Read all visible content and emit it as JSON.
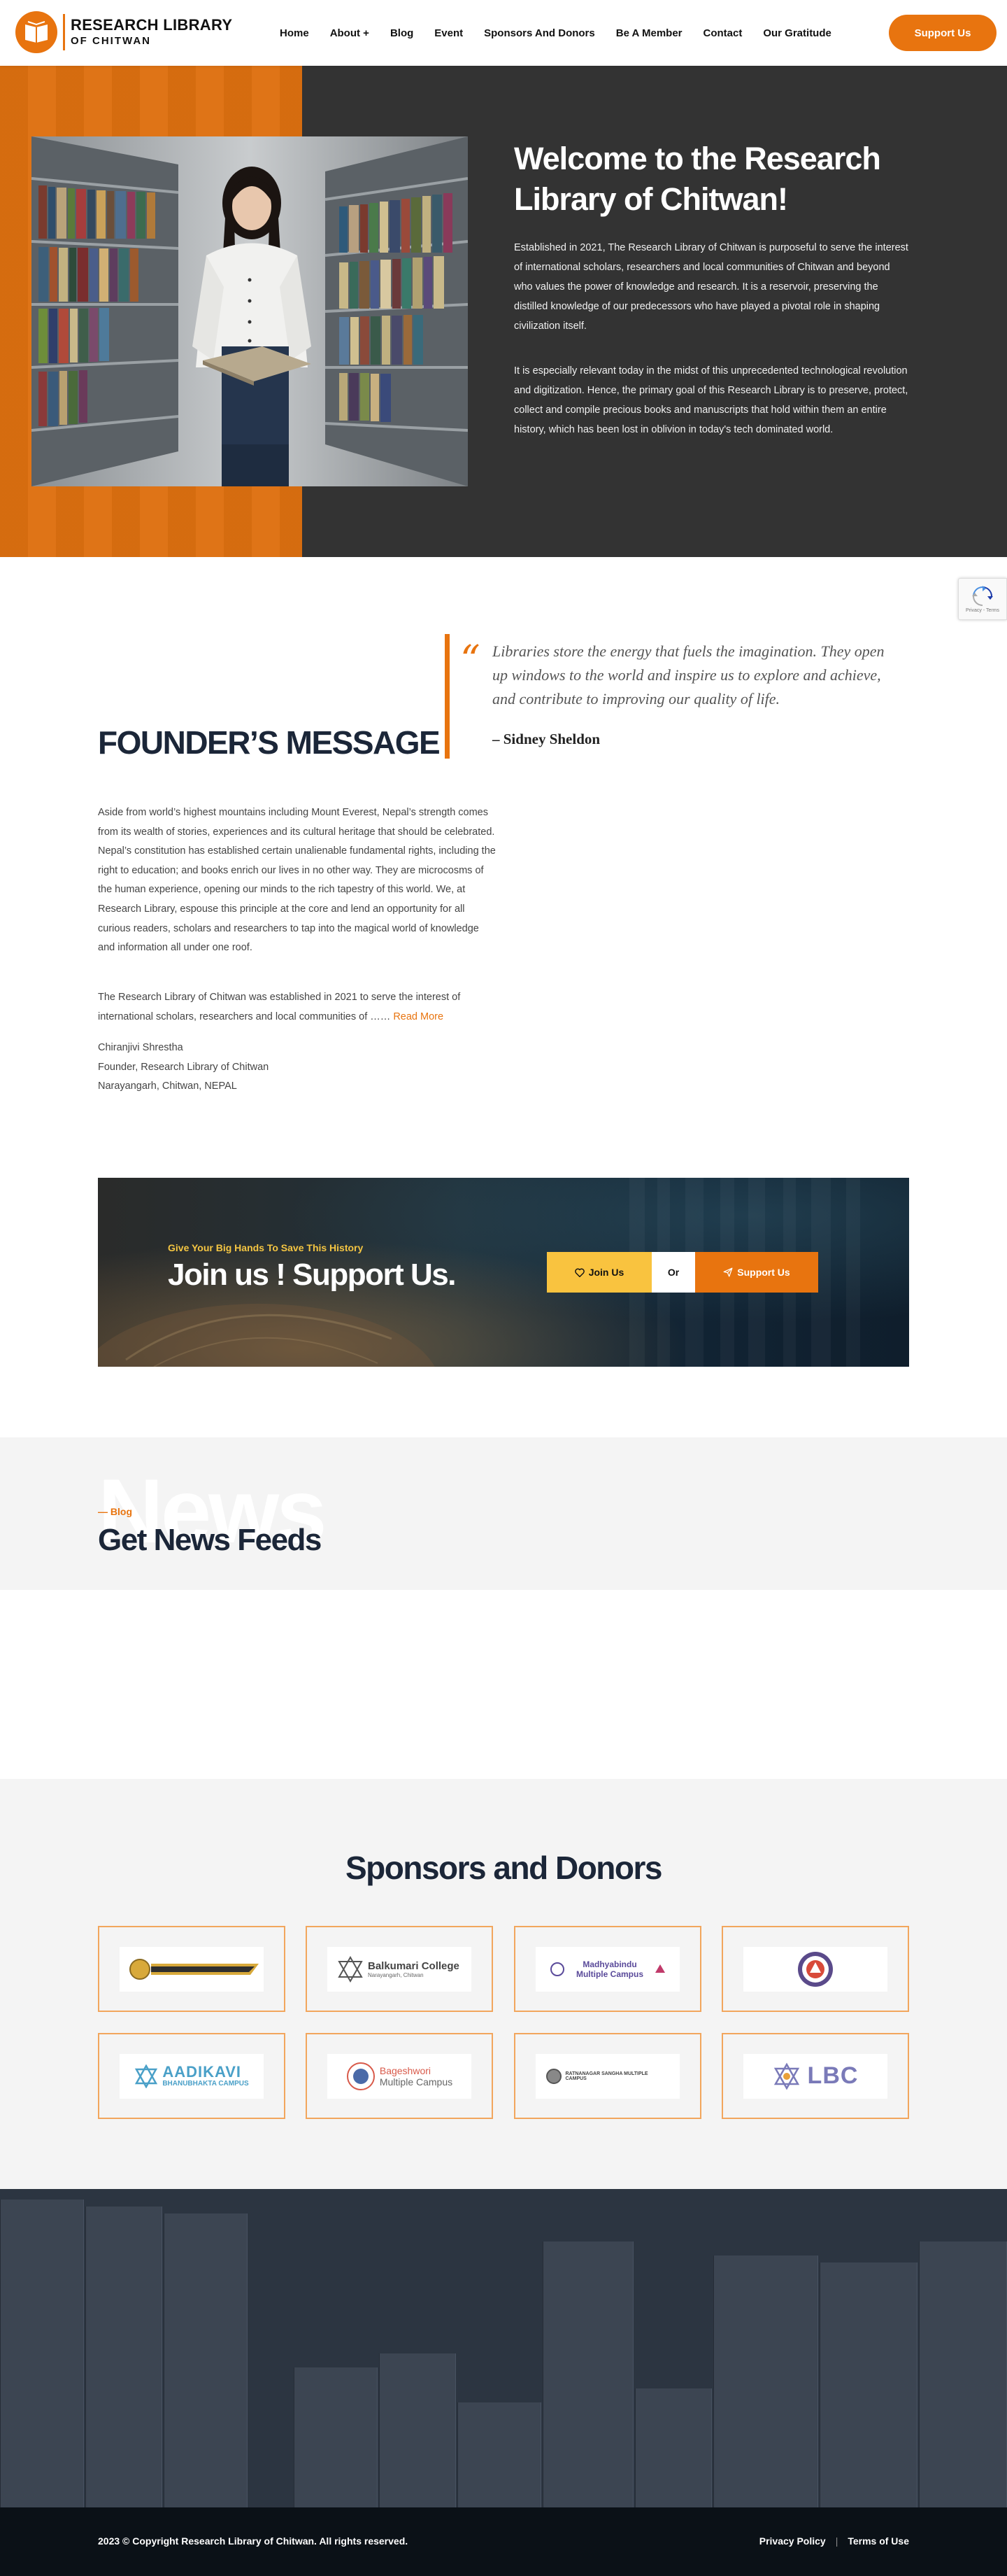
{
  "header": {
    "logo_line1": "RESEARCH LIBRARY",
    "logo_line2": "OF CHITWAN",
    "nav": [
      "Home",
      "About +",
      "Blog",
      "Event",
      "Sponsors And Donors",
      "Be A Member",
      "Contact",
      "Our Gratitude"
    ],
    "support_label": "Support Us"
  },
  "hero": {
    "title": "Welcome to the Research Library of Chitwan!",
    "p1": "Established in 2021, The Research Library of Chitwan is purposeful to serve the interest of international scholars, researchers and local communities of Chitwan and beyond who values the power of knowledge and research. It is a reservoir, preserving the distilled knowledge of our predecessors who have played a pivotal role in shaping civilization itself.",
    "p2": "It is especially relevant today in the midst of this unprecedented technological revolution and digitization. Hence, the primary goal of this Research Library is to preserve, protect, collect and compile precious books and manuscripts that hold within them an entire history, which has been lost in oblivion in today's tech dominated world."
  },
  "founder": {
    "quote_mark": "“",
    "quote": "Libraries store the energy that fuels the imagination. They open up windows to the world and inspire us to explore and achieve, and contribute to improving our quality of life.",
    "quote_author": "– Sidney Sheldon",
    "title": "FOUNDER’S MESSAGE",
    "p1": "Aside from world’s highest mountains including Mount Everest, Nepal’s strength comes from its wealth of stories, experiences and its cultural heritage that should be celebrated. Nepal’s constitution has established certain unalienable fundamental rights, including the right to education; and books enrich our lives in no other way. They are microcosms of the human experience, opening our minds to the rich tapestry of this world. We, at Research Library, espouse this principle at the core and lend an opportunity for all curious readers, scholars and researchers to tap into the magical world of knowledge and information all under one roof.",
    "p2": "The Research Library of Chitwan was established in 2021 to serve the interest of international scholars, researchers and local communities of …… ",
    "read_more": "Read More",
    "sig_name": "Chiranjivi Shrestha",
    "sig_role": "Founder, Research Library of Chitwan",
    "sig_place": "Narayangarh, Chitwan, NEPAL"
  },
  "join": {
    "subtitle": "Give Your Big Hands To Save This History",
    "title": "Join us ! Support Us.",
    "join_label": "Join Us",
    "or_label": "Or",
    "support_label": "Support Us"
  },
  "news": {
    "bg_word": "News",
    "subtitle": "— Blog",
    "title": "Get News Feeds"
  },
  "sponsors": {
    "title": "Sponsors and Donors",
    "logos": [
      {
        "name": "sponsor-logo-1",
        "text": ""
      },
      {
        "name": "balkumari-college-logo",
        "text": "Balkumari College",
        "sub": "Narayangarh, Chitwan"
      },
      {
        "name": "madhyabindu-campus-logo",
        "text": "Madhyabindu Multiple Campus",
        "sub": ""
      },
      {
        "name": "sponsor-emblem-logo",
        "text": ""
      },
      {
        "name": "aadikavi-campus-logo",
        "text": "AADIKAVI",
        "sub": "BHANUBHAKTA CAMPUS"
      },
      {
        "name": "bageshwori-campus-logo",
        "text": "Bageshwori",
        "sub": "Multiple Campus"
      },
      {
        "name": "ratnanagar-campus-logo",
        "text": "RATNANAGAR SANGHA MULTIPLE CAMPUS",
        "sub": ""
      },
      {
        "name": "lbc-logo",
        "text": "LBC",
        "sub": ""
      }
    ]
  },
  "footer": {
    "copyright": "2023 © Copyright Research Library of Chitwan. All rights reserved.",
    "privacy": "Privacy Policy",
    "sep": "|",
    "terms": "Terms of Use"
  },
  "colors": {
    "accent": "#e8740f",
    "dark": "#333333",
    "navy": "#1b2638",
    "yellow": "#f9c33f"
  }
}
